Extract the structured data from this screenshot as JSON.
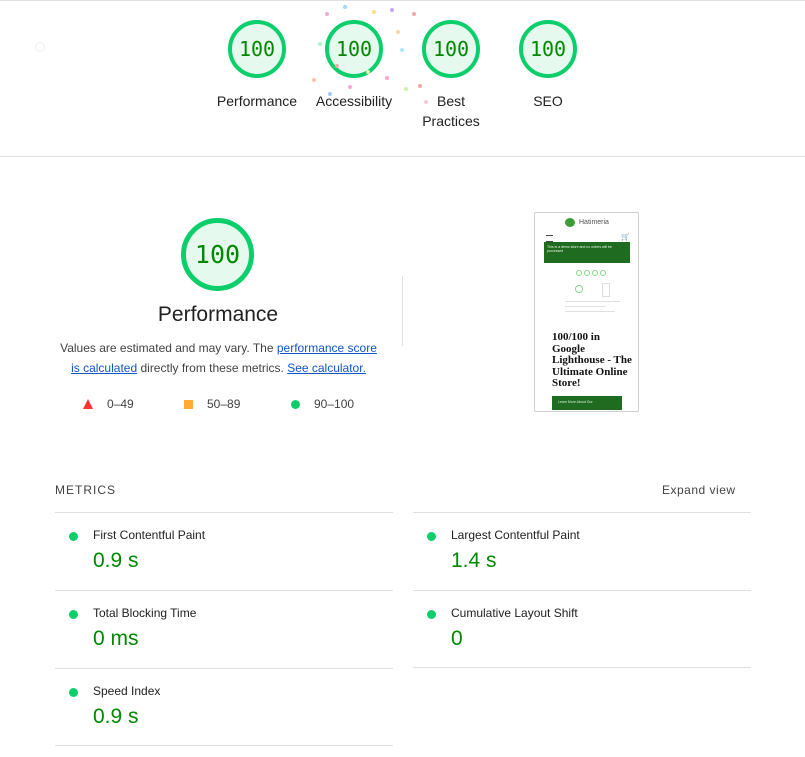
{
  "summary": {
    "gauges": [
      {
        "label": "Performance",
        "value": "100"
      },
      {
        "label": "Accessibility",
        "value": "100"
      },
      {
        "label": "Best Practices",
        "value": "100"
      },
      {
        "label": "SEO",
        "value": "100"
      }
    ]
  },
  "performance": {
    "score": "100",
    "title": "Performance",
    "desc_pre": "Values are estimated and may vary. The ",
    "desc_link1": "performance score is calculated",
    "desc_mid": " directly from these metrics. ",
    "desc_link2": "See calculator.",
    "legend": {
      "fail": "0–49",
      "average": "50–89",
      "pass": "90–100"
    },
    "colors": {
      "pass": "#0cce6b",
      "average": "#ffaa33",
      "fail": "#ff3333"
    }
  },
  "screenshot": {
    "brand": "Hatimeria",
    "banner_text": "This is a demo store and no orders will be processed",
    "headline": "100/100 in Google Lighthouse - The Ultimate Online Store!",
    "button_text": "Learn More About Our"
  },
  "metrics": {
    "header": "METRICS",
    "expand": "Expand view",
    "items": [
      {
        "label": "First Contentful Paint",
        "value": "0.9 s"
      },
      {
        "label": "Largest Contentful Paint",
        "value": "1.4 s"
      },
      {
        "label": "Total Blocking Time",
        "value": "0 ms"
      },
      {
        "label": "Cumulative Layout Shift",
        "value": "0"
      },
      {
        "label": "Speed Index",
        "value": "0.9 s"
      }
    ]
  }
}
